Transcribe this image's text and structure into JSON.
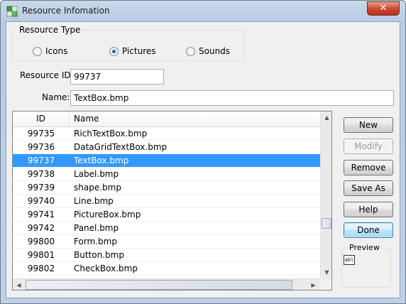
{
  "window": {
    "title": "Resource Infomation",
    "close_label": "✕"
  },
  "resource_type": {
    "legend": "Resource Type",
    "options": [
      {
        "label": "Icons",
        "selected": false
      },
      {
        "label": "Pictures",
        "selected": true
      },
      {
        "label": "Sounds",
        "selected": false
      }
    ]
  },
  "fields": {
    "resource_id_label": "Resource ID:",
    "resource_id_value": "99737",
    "name_label": "Name:",
    "name_value": "TextBox.bmp"
  },
  "list": {
    "columns": [
      "ID",
      "Name"
    ],
    "selected_index": 2,
    "rows": [
      {
        "id": "99735",
        "name": "RichTextBox.bmp"
      },
      {
        "id": "99736",
        "name": "DataGridTextBox.bmp"
      },
      {
        "id": "99737",
        "name": "TextBox.bmp"
      },
      {
        "id": "99738",
        "name": "Label.bmp"
      },
      {
        "id": "99739",
        "name": "shape.bmp"
      },
      {
        "id": "99740",
        "name": "Line.bmp"
      },
      {
        "id": "99741",
        "name": "PictureBox.bmp"
      },
      {
        "id": "99742",
        "name": "Panel.bmp"
      },
      {
        "id": "99800",
        "name": "Form.bmp"
      },
      {
        "id": "99801",
        "name": "Button.bmp"
      },
      {
        "id": "99802",
        "name": "CheckBox.bmp"
      }
    ]
  },
  "buttons": {
    "new": "New",
    "modify": "Modify",
    "remove": "Remove",
    "save_as": "Save As",
    "help": "Help",
    "done": "Done"
  },
  "preview": {
    "legend": "Preview",
    "thumbnail_text": "abl"
  },
  "colors": {
    "selection": "#3399ff",
    "default_button": "#3c7fb1",
    "close_button": "#cc4a31"
  }
}
